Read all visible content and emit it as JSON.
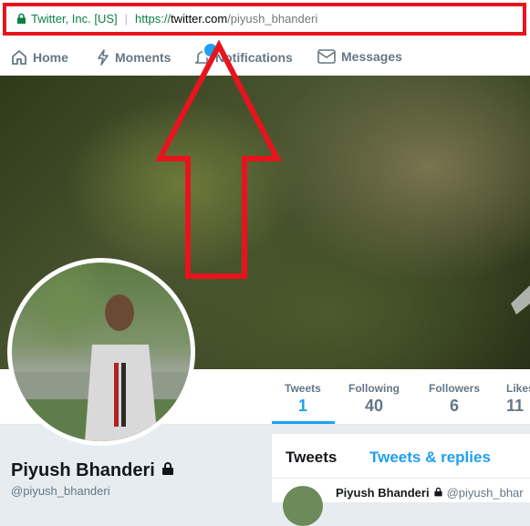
{
  "browser": {
    "site_identity": "Twitter, Inc. [US]",
    "url_scheme": "https://",
    "url_host": "twitter.com",
    "url_path": "/piyush_bhanderi"
  },
  "nav": {
    "home": "Home",
    "moments": "Moments",
    "notifications": "Notifications",
    "messages": "Messages"
  },
  "stats": [
    {
      "label": "Tweets",
      "value": "1"
    },
    {
      "label": "Following",
      "value": "40"
    },
    {
      "label": "Followers",
      "value": "6"
    },
    {
      "label": "Likes",
      "value": "11"
    }
  ],
  "profile": {
    "name": "Piyush Bhanderi",
    "handle": "@piyush_bhanderi"
  },
  "tabs": {
    "tweets": "Tweets",
    "replies": "Tweets & replies"
  },
  "tweet": {
    "name": "Piyush Bhanderi",
    "handle": "@piyush_bhar"
  },
  "colors": {
    "accent": "#1da1f2",
    "annotation": "#e8141d"
  }
}
